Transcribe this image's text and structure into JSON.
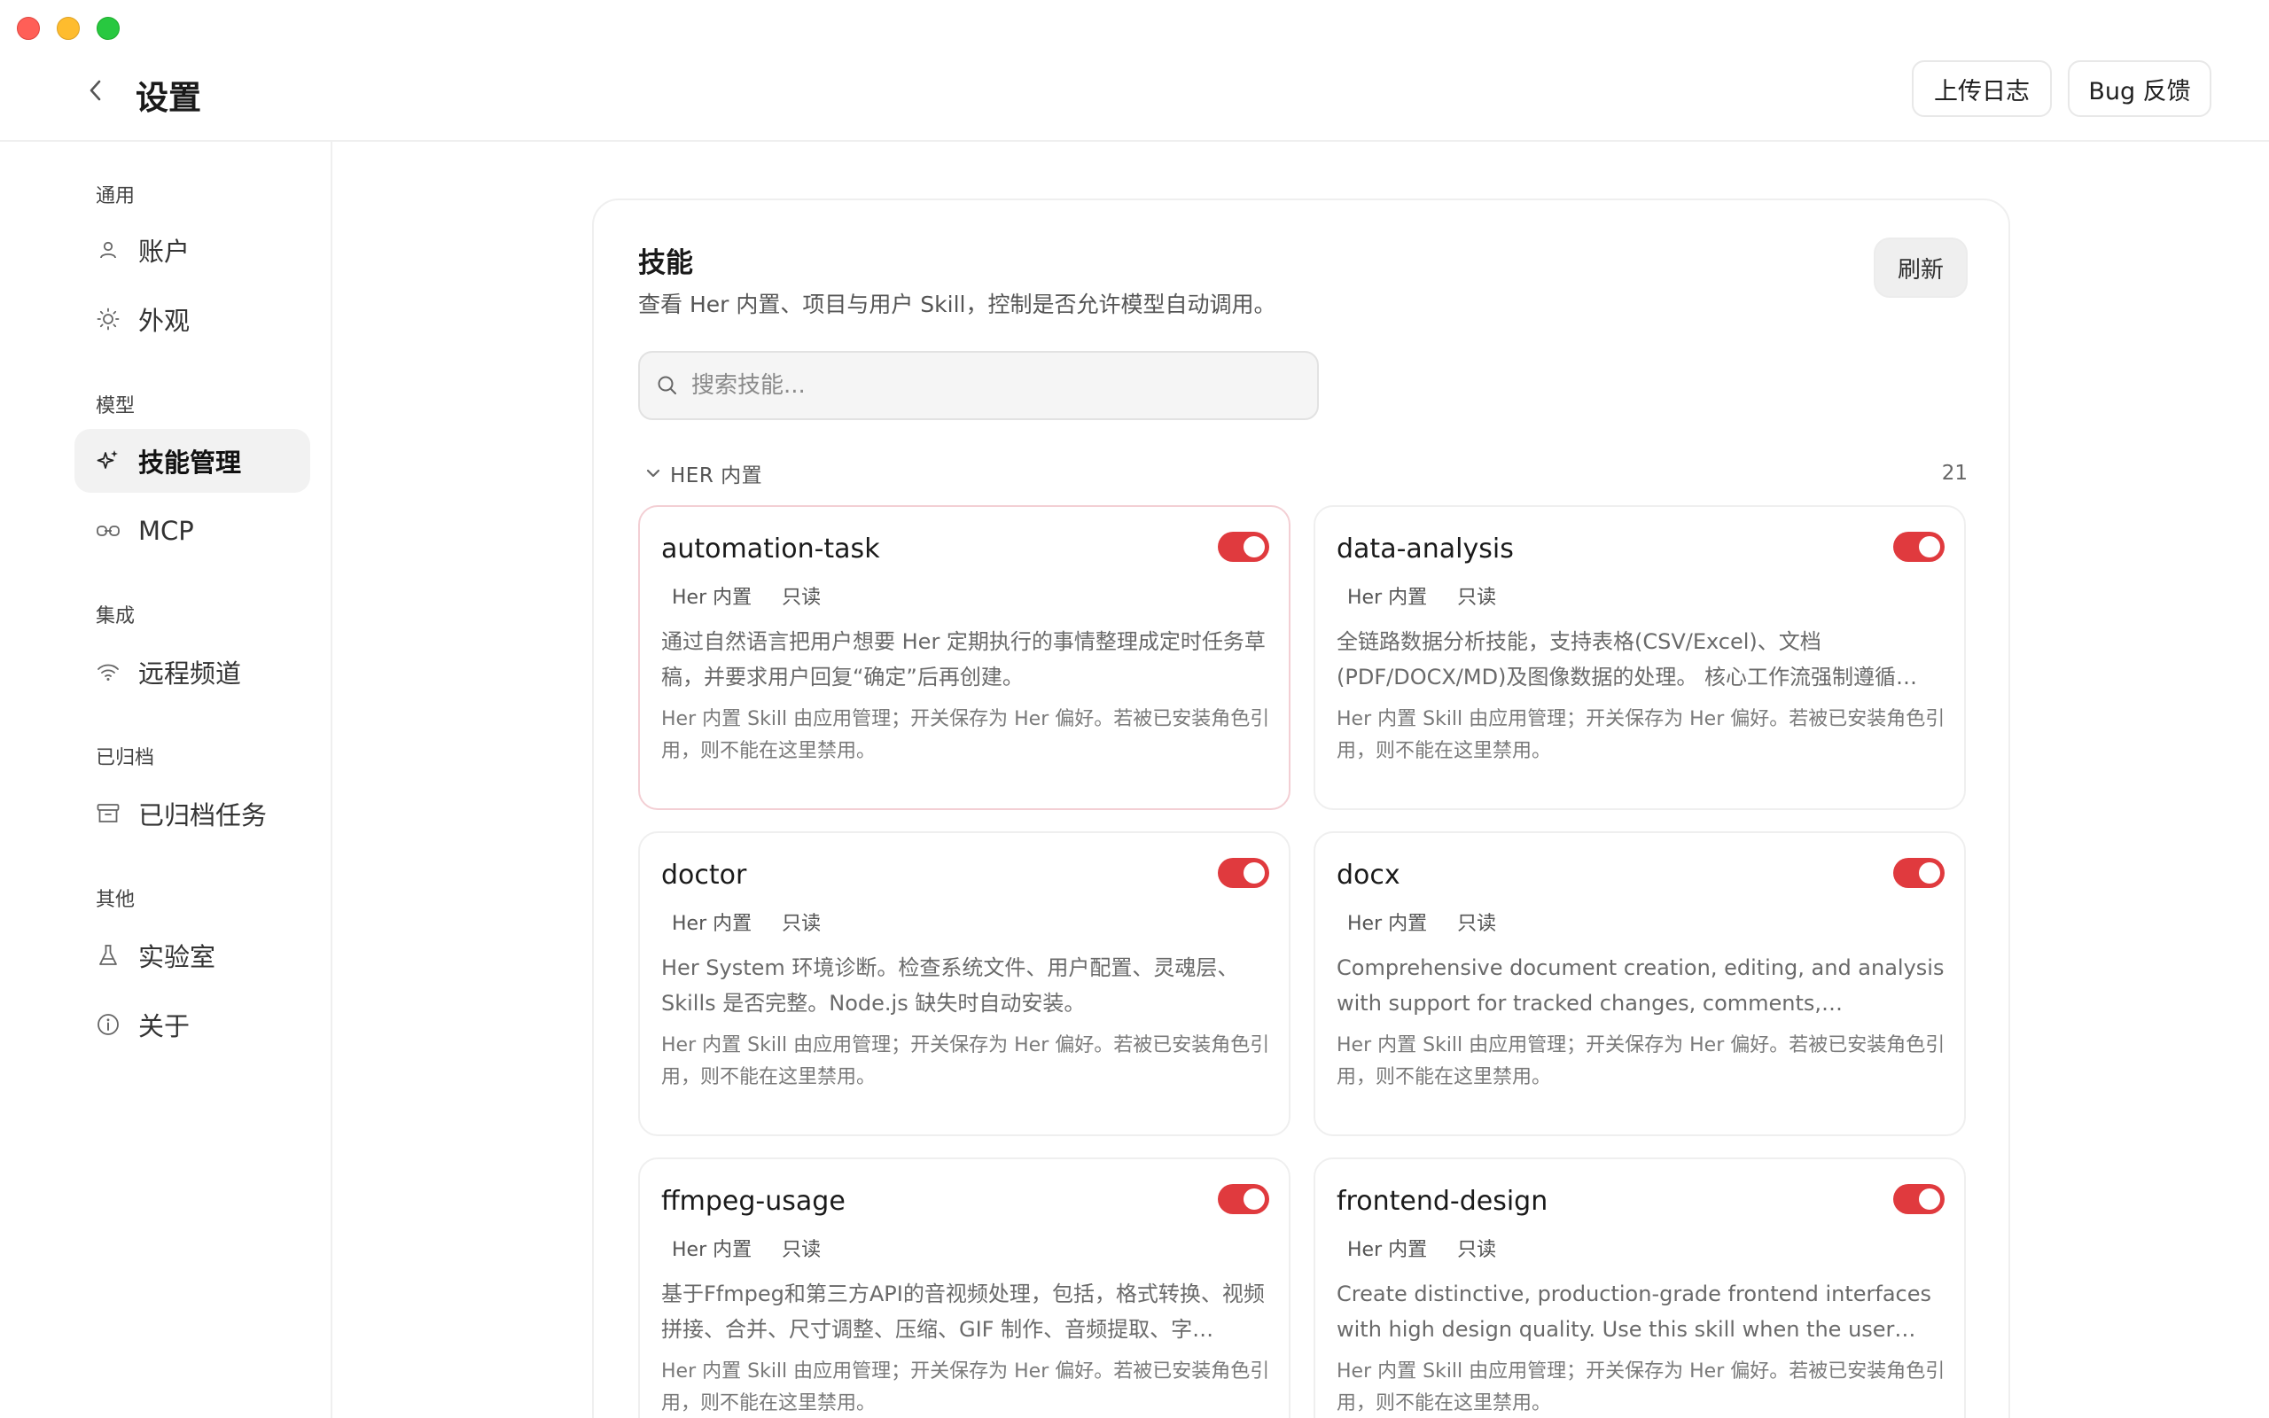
{
  "window": {
    "title": "设置"
  },
  "header": {
    "upload_label": "上传日志",
    "bug_label": "Bug 反馈"
  },
  "sidebar": {
    "sections": [
      {
        "label": "通用",
        "items": [
          {
            "label": "账户",
            "icon": "user-icon"
          },
          {
            "label": "外观",
            "icon": "sun-icon"
          }
        ]
      },
      {
        "label": "模型",
        "items": [
          {
            "label": "技能管理",
            "icon": "sparkle-icon",
            "active": true
          },
          {
            "label": "MCP",
            "icon": "link-icon"
          }
        ]
      },
      {
        "label": "集成",
        "items": [
          {
            "label": "远程频道",
            "icon": "wifi-icon"
          }
        ]
      },
      {
        "label": "已归档",
        "items": [
          {
            "label": "已归档任务",
            "icon": "archive-icon"
          }
        ]
      },
      {
        "label": "其他",
        "items": [
          {
            "label": "实验室",
            "icon": "flask-icon"
          },
          {
            "label": "关于",
            "icon": "info-icon"
          }
        ]
      }
    ]
  },
  "main": {
    "title": "技能",
    "subtitle": "查看 Her 内置、项目与用户 Skill，控制是否允许模型自动调用。",
    "refresh_label": "刷新",
    "search_placeholder": "搜索技能...",
    "group": {
      "label": "HER 内置",
      "count": "21"
    },
    "accent_color": "#e03a3e",
    "cards": [
      {
        "name": "automation-task",
        "tag1": "Her 内置",
        "tag2": "只读",
        "enabled": true,
        "desc": "通过自然语言把用户想要 Her 定期执行的事情整理成定时任务草稿，并要求用户回复“确定”后再创建。",
        "note": "Her 内置 Skill 由应用管理；开关保存为 Her 偏好。若被已安装角色引用，则不能在这里禁用。"
      },
      {
        "name": "data-analysis",
        "tag1": "Her 内置",
        "tag2": "只读",
        "enabled": true,
        "desc": "全链路数据分析技能，支持表格(CSV/Excel)、文档(PDF/DOCX/MD)及图像数据的处理。 核心工作流强制遵循…",
        "note": "Her 内置 Skill 由应用管理；开关保存为 Her 偏好。若被已安装角色引用，则不能在这里禁用。"
      },
      {
        "name": "doctor",
        "tag1": "Her 内置",
        "tag2": "只读",
        "enabled": true,
        "desc": "Her System 环境诊断。检查系统文件、用户配置、灵魂层、Skills 是否完整。Node.js 缺失时自动安装。",
        "note": "Her 内置 Skill 由应用管理；开关保存为 Her 偏好。若被已安装角色引用，则不能在这里禁用。"
      },
      {
        "name": "docx",
        "tag1": "Her 内置",
        "tag2": "只读",
        "enabled": true,
        "desc": "Comprehensive document creation, editing, and analysis with support for tracked changes, comments, formatting…",
        "note": "Her 内置 Skill 由应用管理；开关保存为 Her 偏好。若被已安装角色引用，则不能在这里禁用。"
      },
      {
        "name": "ffmpeg-usage",
        "tag1": "Her 内置",
        "tag2": "只读",
        "enabled": true,
        "desc": "基于Ffmpeg和第三方API的音视频处理，包括，格式转换、视频拼接、合并、尺寸调整、压缩、GIF 制作、音频提取、字…",
        "note": "Her 内置 Skill 由应用管理；开关保存为 Her 偏好。若被已安装角色引用，则不能在这里禁用。"
      },
      {
        "name": "frontend-design",
        "tag1": "Her 内置",
        "tag2": "只读",
        "enabled": true,
        "desc": "Create distinctive, production-grade frontend interfaces with high design quality. Use this skill when the user asks…",
        "note": "Her 内置 Skill 由应用管理；开关保存为 Her 偏好。若被已安装角色引用，则不能在这里禁用。"
      }
    ]
  }
}
